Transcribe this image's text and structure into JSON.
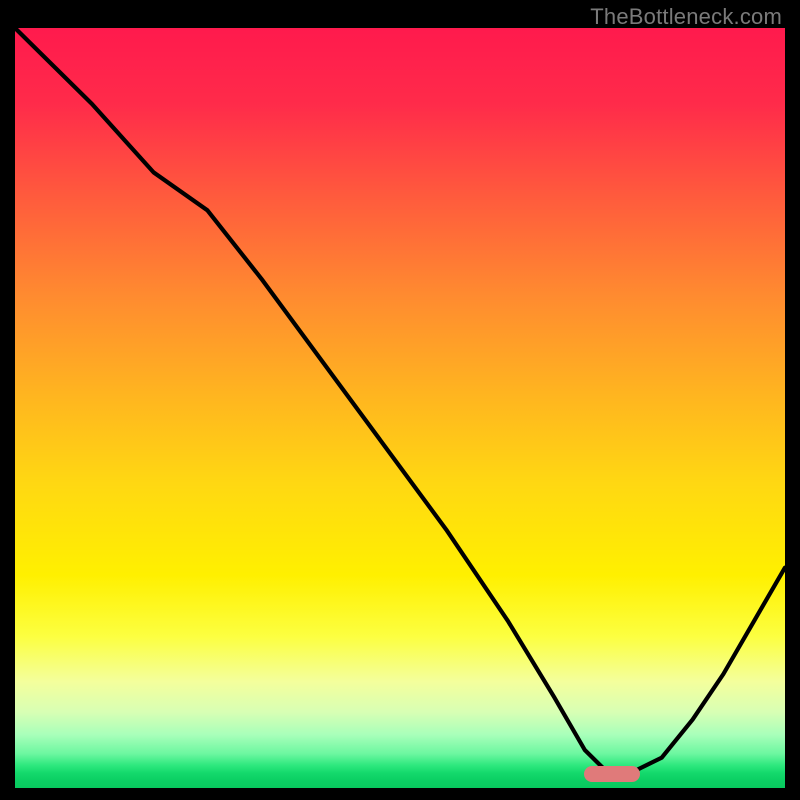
{
  "watermark": "TheBottleneck.com",
  "marker": {
    "x_pct": 77.5,
    "y_pct": 98.2
  },
  "chart_data": {
    "type": "line",
    "title": "",
    "xlabel": "",
    "ylabel": "",
    "xlim": [
      0,
      100
    ],
    "ylim": [
      0,
      100
    ],
    "grid": false,
    "legend": false,
    "background_gradient_stops": [
      {
        "pos": 0,
        "color": "#ff1a4d",
        "meaning": "worst"
      },
      {
        "pos": 50,
        "color": "#ffc018"
      },
      {
        "pos": 75,
        "color": "#fff200"
      },
      {
        "pos": 100,
        "color": "#08c95e",
        "meaning": "best"
      }
    ],
    "series": [
      {
        "name": "bottleneck-curve",
        "x": [
          0,
          10,
          18,
          25,
          32,
          40,
          48,
          56,
          64,
          70,
          74,
          77,
          80,
          84,
          88,
          92,
          96,
          100
        ],
        "y_pct": [
          0,
          10,
          19,
          24,
          33,
          44,
          55,
          66,
          78,
          88,
          95,
          98,
          98,
          96,
          91,
          85,
          78,
          71
        ]
      }
    ],
    "optimal_marker": {
      "x_pct": 77.5,
      "y_pct": 98.2,
      "color": "#e07a7a"
    },
    "note": "y_pct is distance from the top (0=top edge, 100=bottom edge). Higher y_pct = lower bottleneck (green zone)."
  }
}
